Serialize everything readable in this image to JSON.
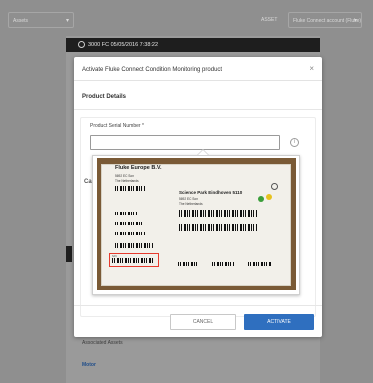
{
  "background": {
    "left_select": "Assets",
    "right_label": "ASSET",
    "right_select": "Fluke Connect account (Fluke)",
    "status_bar": "3000 FC    05/05/2016 7:38:22",
    "associated_label": "Associated Assets",
    "link": "Motor"
  },
  "modal": {
    "title": "Activate Fluke Connect Condition Monitoring product",
    "section_title": "Product Details",
    "serial_label": "Product Serial Number *",
    "serial_value": "",
    "serial_placeholder": "",
    "cut_label": "Ca",
    "cancel_label": "CANCEL",
    "activate_label": "ACTIVATE"
  },
  "photo": {
    "company": "Fluke Europe B.V.",
    "company2": "Science Park Eindhoven 5110",
    "addr1": "5692 EC Son",
    "addr2": "The Netherlands",
    "serial_field": "S/N"
  },
  "colors": {
    "accent": "#2f6fbf",
    "highlight": "#e63b2e",
    "dot_green": "#3a9e3a",
    "dot_yellow": "#e6c21f"
  }
}
